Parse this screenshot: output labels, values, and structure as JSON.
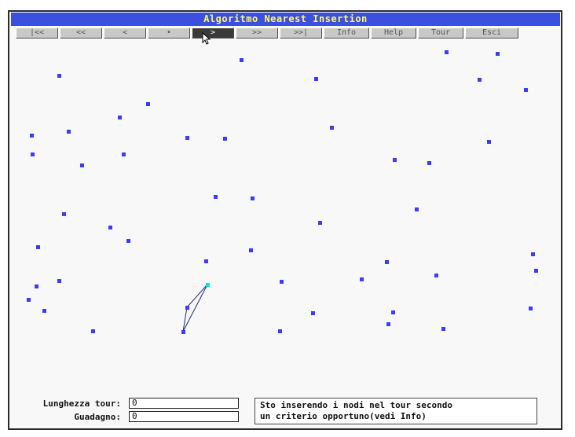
{
  "window": {
    "title": "Algoritmo Nearest Insertion"
  },
  "toolbar": {
    "buttons": [
      {
        "label": "|<<",
        "active": false
      },
      {
        "label": "<<",
        "active": false
      },
      {
        "label": "<",
        "active": false
      },
      {
        "label": "•",
        "active": false
      },
      {
        "label": ">",
        "active": true
      },
      {
        "label": ">>",
        "active": false
      },
      {
        "label": ">>|",
        "active": false
      },
      {
        "label": "Info",
        "active": false
      },
      {
        "label": "Help",
        "active": false
      },
      {
        "label": "Tour",
        "active": false
      },
      {
        "label": "Esci",
        "active": false
      }
    ]
  },
  "status": {
    "tour_length_label": "Lunghezza tour:",
    "tour_length_value": "0",
    "gain_label": "Guadagno:",
    "gain_value": "0",
    "message_line1": "Sto inserendo i nodi nel tour secondo",
    "message_line2": "un criterio opportuno(vedi Info)"
  },
  "colors": {
    "node": "#3b3bff",
    "current_node": "#00e5e5",
    "tour_edge": "#1a2a8a",
    "title_bg": "#3b4fe0",
    "title_text": "#ffff55"
  },
  "graph": {
    "tour": [
      32,
      35,
      36
    ],
    "current_node": 36
  }
}
